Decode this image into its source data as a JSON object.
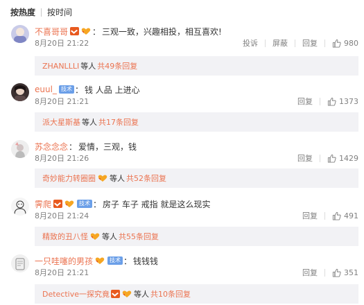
{
  "sort": {
    "hot": "按热度",
    "time": "按时间"
  },
  "comments": [
    {
      "user": "不喜哥哥",
      "text": "三观一致，兴趣相投，相互喜欢!",
      "date": "8月20日 21:22",
      "report": "投诉",
      "block": "屏蔽",
      "reply": "回复",
      "likes": "980",
      "reply_user": "ZHANLLLI",
      "reply_mid": "等人",
      "reply_count": "共49条回复"
    },
    {
      "user": "euul_",
      "tag": "技术",
      "text": "钱 人品 上进心",
      "date": "8月20日 21:21",
      "reply": "回复",
      "likes": "1373",
      "reply_user": "派大星斯基",
      "reply_mid": "等人",
      "reply_count": "共17条回复"
    },
    {
      "user": "苏念念念",
      "text": "爱情，三观，钱",
      "date": "8月20日 21:26",
      "reply": "回复",
      "likes": "1429",
      "reply_user": "奇妙能力转圈圈",
      "reply_mid": "等人",
      "reply_count": "共52条回复"
    },
    {
      "user": "霁爬",
      "tag": "技术",
      "text": "房子 车子 戒指 就是这么现实",
      "date": "8月20日 21:24",
      "reply": "回复",
      "likes": "491",
      "reply_user": "精致的丑八怪",
      "reply_mid": "等人",
      "reply_count": "共55条回复"
    },
    {
      "user": "一只哇噻的男孩",
      "tag": "技术",
      "text": "钱钱钱",
      "date": "8月20日 21:21",
      "reply": "回复",
      "likes": "351",
      "reply_user": "Detective一探究竟",
      "reply_mid": "等人",
      "reply_count": "共10条回复"
    }
  ],
  "colors": {
    "name": "#eb7350",
    "meta": "#808080",
    "reply_bg": "#f2f2f5",
    "vip_badge": "#e85a1f",
    "tag_badge": "#6b9fe8"
  }
}
